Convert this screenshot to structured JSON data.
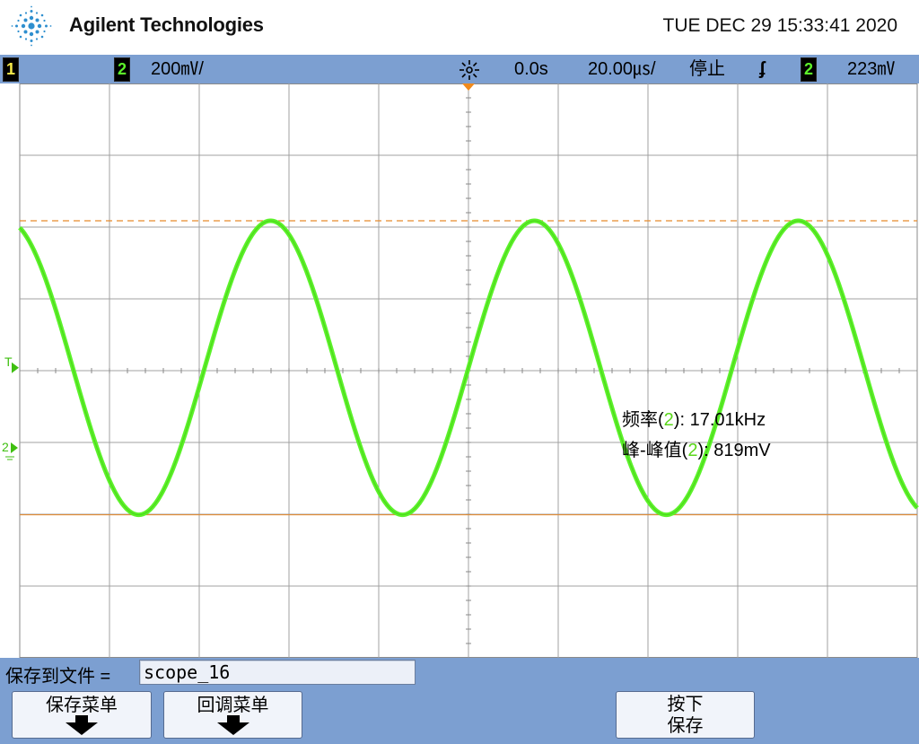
{
  "header": {
    "brand": "Agilent Technologies",
    "datetime": "TUE DEC 29 15:33:41 2020"
  },
  "status": {
    "ch1_label": "1",
    "ch2_label": "2",
    "ch2_scale": "200㎷/",
    "run_icon": "sun-star-icon",
    "delay": "0.0s",
    "timebase": "20.00㎲/",
    "run_state": "停止",
    "trigger_edge": "ʄ",
    "trigger_ch": "2",
    "trigger_level": "223㎷"
  },
  "plot": {
    "trigger_marker": "T",
    "ch2_marker": "2",
    "colors": {
      "trace": "#5cf22a",
      "grid": "#a0a0a0",
      "cursor": "#e78a2a",
      "ch1": "#f4e94a",
      "ch2": "#5cf22a"
    },
    "signal": {
      "frequency_khz": 17.01,
      "vpp_mv": 819,
      "volts_per_div_mv": 200,
      "time_per_div_us": 20,
      "trigger_level_mv": 223
    }
  },
  "measurements": {
    "freq_label": "频率(",
    "freq_ch": "2",
    "freq_value": "): 17.01kHz",
    "vpp_label": "峰-峰值(",
    "vpp_ch": "2",
    "vpp_value": "): 819mV"
  },
  "save": {
    "label": "保存到文件 =",
    "filename": "scope_16"
  },
  "softkeys": {
    "save_menu": "保存菜单",
    "recall_menu": "回调菜单",
    "press_line1": "按下",
    "press_line2": "保存"
  }
}
